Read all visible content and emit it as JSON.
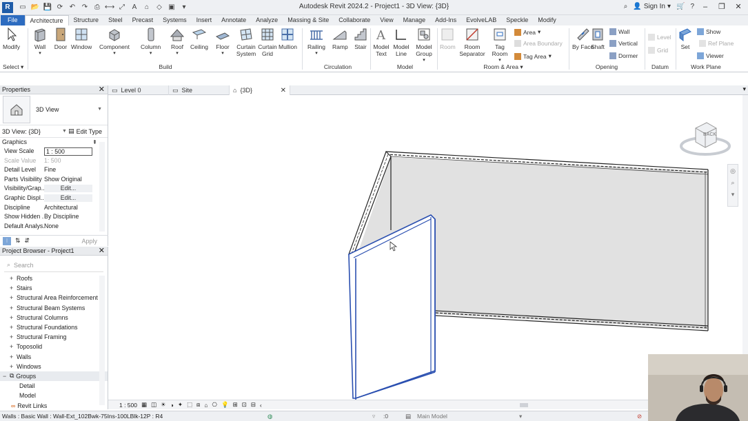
{
  "app": {
    "title": "Autodesk Revit 2024.2 - Project1 - 3D View: {3D}",
    "sign_in": "Sign In",
    "logo": "R"
  },
  "tabs": [
    "File",
    "Architecture",
    "Structure",
    "Steel",
    "Precast",
    "Systems",
    "Insert",
    "Annotate",
    "Analyze",
    "Massing & Site",
    "Collaborate",
    "View",
    "Manage",
    "Add-Ins",
    "EvolveLAB",
    "Speckle",
    "Modify"
  ],
  "ribbon": {
    "modify": "Modify",
    "select": "Select",
    "build": {
      "label": "Build",
      "items": [
        "Wall",
        "Door",
        "Window",
        "Component",
        "Column",
        "Roof",
        "Ceiling",
        "Floor",
        "Curtain System",
        "Curtain Grid",
        "Mullion"
      ]
    },
    "circulation": {
      "label": "Circulation",
      "items": [
        "Railing",
        "Ramp",
        "Stair"
      ]
    },
    "model": {
      "label": "Model",
      "items": [
        "Model Text",
        "Model Line",
        "Model Group"
      ]
    },
    "room_area": {
      "label": "Room & Area",
      "items": [
        "Room",
        "Room Separator",
        "Tag Room"
      ],
      "area": "Area",
      "area_boundary": "Area Boundary",
      "tag_area": "Tag Area"
    },
    "opening": {
      "label": "Opening",
      "by_face": "By Face",
      "shaft": "Shaft",
      "wall": "Wall",
      "vertical": "Vertical",
      "dormer": "Dormer"
    },
    "datum": {
      "label": "Datum",
      "level": "Level",
      "grid": "Grid",
      "ref_plane": "Ref Plane"
    },
    "work_plane": {
      "label": "Work Plane",
      "set": "Set",
      "show": "Show",
      "viewer": "Viewer"
    }
  },
  "properties": {
    "title": "Properties",
    "type_name": "3D View",
    "instance": "3D View: {3D}",
    "edit_type": "Edit Type",
    "group": "Graphics",
    "rows": [
      {
        "k": "View Scale",
        "v": "1 : 500"
      },
      {
        "k": "Scale Value",
        "v": "1:  500"
      },
      {
        "k": "Detail Level",
        "v": "Fine"
      },
      {
        "k": "Parts Visibility",
        "v": "Show Original"
      },
      {
        "k": "Visibility/Grap...",
        "v": "Edit..."
      },
      {
        "k": "Graphic Displ...",
        "v": "Edit..."
      },
      {
        "k": "Discipline",
        "v": "Architectural"
      },
      {
        "k": "Show Hidden ...",
        "v": "By Discipline"
      },
      {
        "k": "Default Analys...",
        "v": "None"
      }
    ],
    "apply": "Apply"
  },
  "browser": {
    "title": "Project Browser - Project1",
    "search_placeholder": "Search",
    "items": [
      "Roofs",
      "Stairs",
      "Structural Area Reinforcement",
      "Structural Beam Systems",
      "Structural Columns",
      "Structural Foundations",
      "Structural Framing",
      "Toposolid",
      "Walls",
      "Windows"
    ],
    "groups": "Groups",
    "group_children": [
      "Detail",
      "Model"
    ],
    "revit_links": "Revit Links"
  },
  "view_tabs": [
    {
      "label": "Level 0"
    },
    {
      "label": "Site"
    },
    {
      "label": "{3D}"
    }
  ],
  "view_control": {
    "scale": "1 : 500"
  },
  "viewcube": {
    "face": "BACK"
  },
  "status": {
    "text": "Walls : Basic Wall : Wall-Ext_102Bwk-75Ins-100LBlk-12P : R4",
    "worksets": ":0",
    "model": "Main Model"
  },
  "colors": {
    "file_tab": "#2d6cc0",
    "selection": "#2a4fb0",
    "wall_face": "#e1e1e1"
  }
}
